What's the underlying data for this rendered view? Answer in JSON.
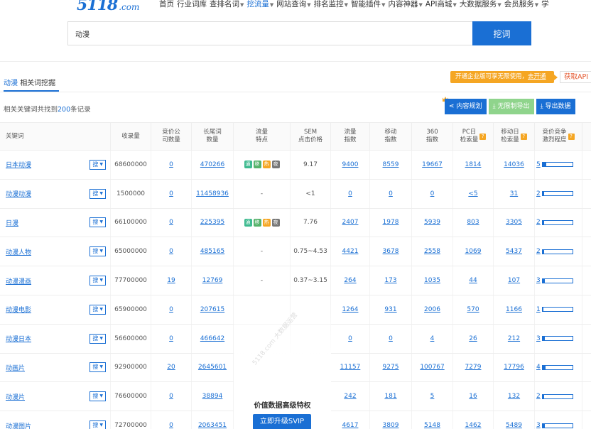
{
  "nav": {
    "logo": "5118",
    "logo_suffix": ".com",
    "items": [
      {
        "label": "首页",
        "caret": false
      },
      {
        "label": "行业词库",
        "caret": false
      },
      {
        "label": "查排名词",
        "caret": true
      },
      {
        "label": "挖流量",
        "caret": true,
        "active": true
      },
      {
        "label": "网站查询",
        "caret": true
      },
      {
        "label": "排名监控",
        "caret": true
      },
      {
        "label": "智能插件",
        "caret": true
      },
      {
        "label": "内容神器",
        "caret": true
      },
      {
        "label": "API商城",
        "caret": true
      },
      {
        "label": "大数据服务",
        "caret": true
      },
      {
        "label": "会员服务",
        "caret": true
      },
      {
        "label": "学",
        "caret": false
      }
    ]
  },
  "search": {
    "value": "动漫",
    "button": "挖词"
  },
  "tab": {
    "keyword": "动漫",
    "title": "相关词挖掘"
  },
  "promo": {
    "text": "开通企业版可享无限使用，",
    "link": "去开通"
  },
  "api_button": "获取API",
  "summary": {
    "prefix": "相关关键词共找到",
    "count": "200",
    "suffix": "条记录"
  },
  "toolbar": {
    "content_plan": "内容规划",
    "unlimited_export": "无限制导出",
    "export_data": "导出数据"
  },
  "columns": [
    "关键词",
    "收录量",
    "竞价公\n司数量",
    "长尾词\n数量",
    "流量\n特点",
    "SEM\n点击价格",
    "流量\n指数",
    "移动\n指数",
    "360\n指数",
    "PC日\n检索量",
    "移动日\n检索量",
    "竞价竞争\n激烈程度"
  ],
  "search_btn_label": "搜",
  "feature_labels": [
    "通",
    "移",
    "热",
    "夜"
  ],
  "rows": [
    {
      "kw": "日本动漫",
      "shoulu": "68600000",
      "bid": "0",
      "longtail": "470266",
      "feat": true,
      "sem": "9.17",
      "flow": "9400",
      "mobile": "8559",
      "i360": "19667",
      "pc": "1814",
      "mday": "14036",
      "comp": "5",
      "compv": 0.12
    },
    {
      "kw": "动漫动漫",
      "shoulu": "1500000",
      "bid": "0",
      "longtail": "11458936",
      "feat": false,
      "sem": "<1",
      "flow": "0",
      "mobile": "0",
      "i360": "0",
      "pc": "<5",
      "mday": "31",
      "comp": "2",
      "compv": 0.05
    },
    {
      "kw": "日漫",
      "shoulu": "66100000",
      "bid": "0",
      "longtail": "225395",
      "feat": true,
      "sem": "7.76",
      "flow": "2407",
      "mobile": "1978",
      "i360": "5939",
      "pc": "803",
      "mday": "3305",
      "comp": "2",
      "compv": 0.05
    },
    {
      "kw": "动漫人物",
      "shoulu": "65000000",
      "bid": "0",
      "longtail": "485165",
      "feat": false,
      "sem": "0.75~4.53",
      "flow": "4421",
      "mobile": "3678",
      "i360": "2558",
      "pc": "1069",
      "mday": "5437",
      "comp": "2",
      "compv": 0.05
    },
    {
      "kw": "动漫漫画",
      "shoulu": "77700000",
      "bid": "19",
      "longtail": "12769",
      "feat": false,
      "sem": "0.37~3.15",
      "flow": "264",
      "mobile": "173",
      "i360": "1035",
      "pc": "44",
      "mday": "107",
      "comp": "3",
      "compv": 0.07
    },
    {
      "kw": "动漫电影",
      "shoulu": "65900000",
      "bid": "0",
      "longtail": "207615",
      "feat": false,
      "sem": "",
      "flow": "1264",
      "mobile": "931",
      "i360": "2006",
      "pc": "570",
      "mday": "1166",
      "comp": "1",
      "compv": 0.03
    },
    {
      "kw": "动漫日本",
      "shoulu": "56600000",
      "bid": "0",
      "longtail": "466642",
      "feat": false,
      "sem": "",
      "flow": "0",
      "mobile": "0",
      "i360": "4",
      "pc": "26",
      "mday": "212",
      "comp": "3",
      "compv": 0.07
    },
    {
      "kw": "动画片",
      "shoulu": "92900000",
      "bid": "20",
      "longtail": "2645601",
      "feat": false,
      "sem": "",
      "flow": "11157",
      "mobile": "9275",
      "i360": "100767",
      "pc": "7279",
      "mday": "17796",
      "comp": "4",
      "compv": 0.09
    },
    {
      "kw": "动漫片",
      "shoulu": "76600000",
      "bid": "0",
      "longtail": "38894",
      "feat": false,
      "sem": "",
      "flow": "242",
      "mobile": "181",
      "i360": "5",
      "pc": "16",
      "mday": "132",
      "comp": "2",
      "compv": 0.05
    },
    {
      "kw": "动漫图片",
      "shoulu": "72700000",
      "bid": "0",
      "longtail": "2063451",
      "feat": false,
      "sem": "",
      "flow": "4617",
      "mobile": "3809",
      "i360": "5148",
      "pc": "1462",
      "mday": "5489",
      "comp": "3",
      "compv": 0.07
    }
  ],
  "dash": "-",
  "vip": {
    "text": "价值数据高级特权",
    "button": "立即升级SVIP"
  },
  "watermark": "5118.com 大数据运营",
  "colors": {
    "primary": "#1a6fd4",
    "orange": "#f5a623",
    "green": "#8fd48c"
  }
}
